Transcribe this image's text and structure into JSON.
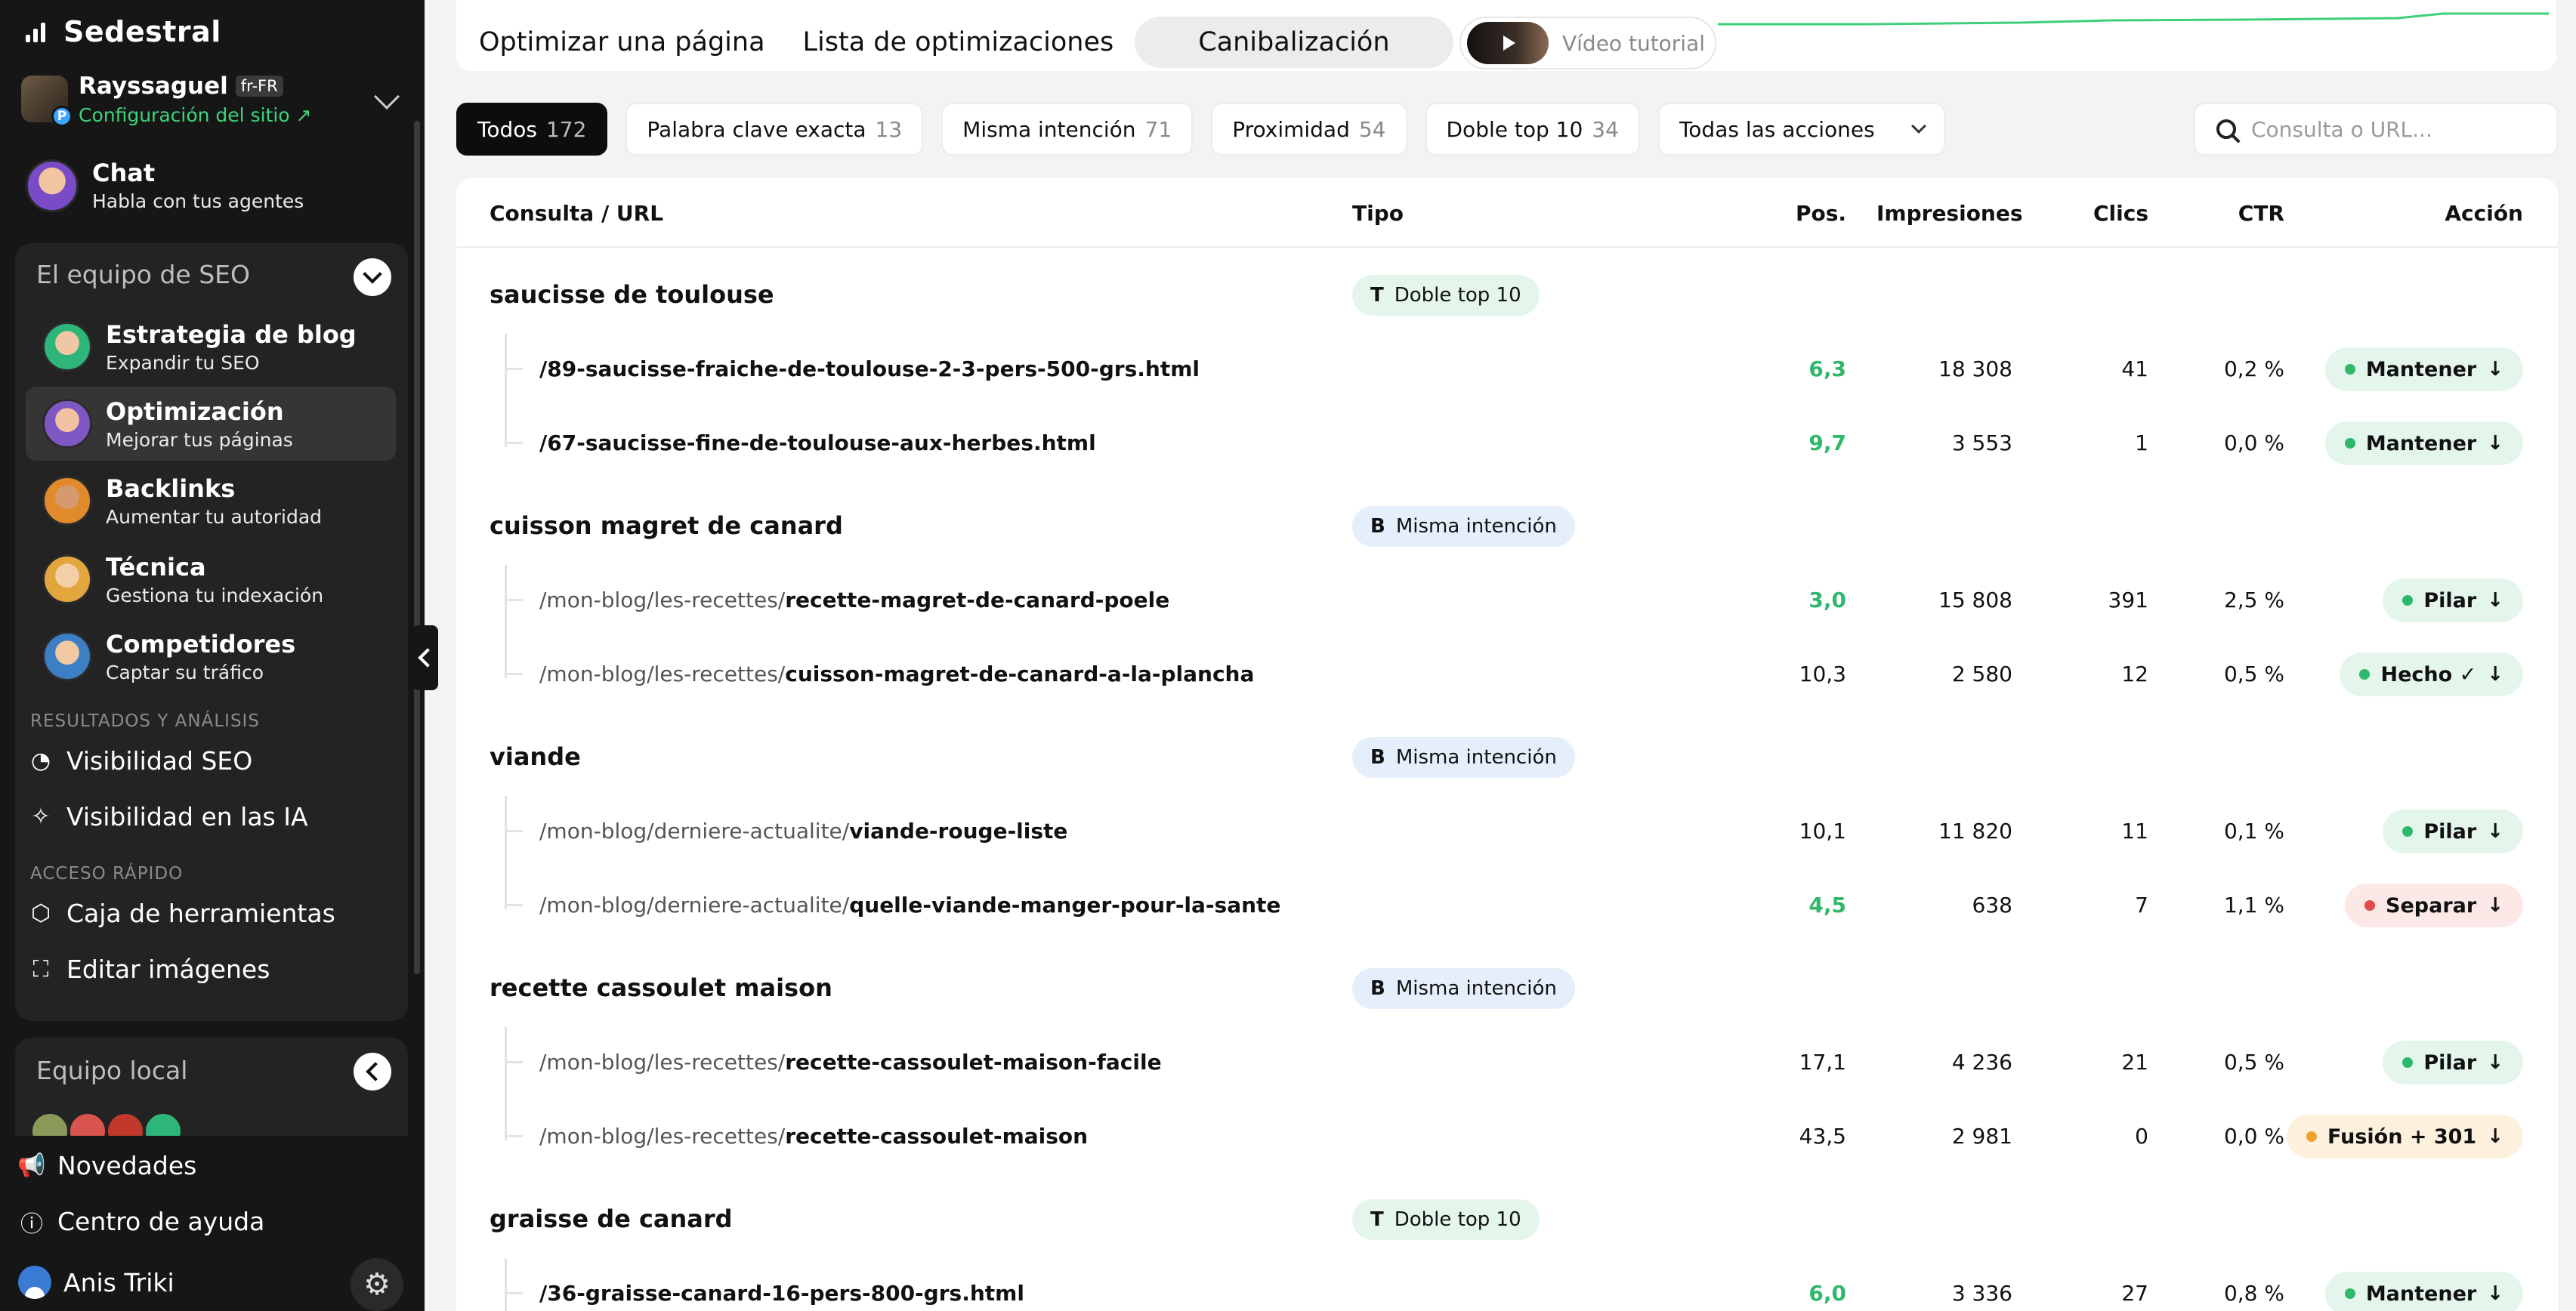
{
  "sidebar": {
    "brand": "Sedestral",
    "site": {
      "name": "Rayssaguel",
      "lang": "fr-FR",
      "config_link": "Configuración del sitio ↗",
      "badge": "P"
    },
    "chat": {
      "title": "Chat",
      "subtitle": "Habla con tus agentes"
    },
    "seo_team": {
      "title": "El equipo de SEO",
      "items": [
        {
          "title": "Estrategia de blog",
          "subtitle": "Expandir tu SEO"
        },
        {
          "title": "Optimización",
          "subtitle": "Mejorar tus páginas"
        },
        {
          "title": "Backlinks",
          "subtitle": "Aumentar tu autoridad"
        },
        {
          "title": "Técnica",
          "subtitle": "Gestiona tu indexación"
        },
        {
          "title": "Competidores",
          "subtitle": "Captar su tráfico"
        }
      ]
    },
    "results_label": "RESULTADOS Y ANÁLISIS",
    "results_items": [
      {
        "label": "Visibilidad SEO"
      },
      {
        "label": "Visibilidad en las IA"
      }
    ],
    "quick_label": "ACCESO RÁPIDO",
    "quick_items": [
      {
        "label": "Caja de herramientas"
      },
      {
        "label": "Editar imágenes"
      }
    ],
    "local_team": {
      "title": "Equipo local"
    },
    "bottom": {
      "news": "Novedades",
      "help": "Centro de ayuda",
      "user": "Anis Triki"
    }
  },
  "top": {
    "tabs": [
      "Optimizar una página",
      "Lista de optimizaciones",
      "Canibalización"
    ],
    "active_tab": 2,
    "video_label": "Vídeo tutorial"
  },
  "filters": [
    {
      "label": "Todos",
      "count": "172"
    },
    {
      "label": "Palabra clave exacta",
      "count": "13"
    },
    {
      "label": "Misma intención",
      "count": "71"
    },
    {
      "label": "Proximidad",
      "count": "54"
    },
    {
      "label": "Doble top 10",
      "count": "34"
    }
  ],
  "actions_select": "Todas las acciones",
  "search": {
    "placeholder": "Consulta o URL..."
  },
  "table": {
    "headers": {
      "query": "Consulta / URL",
      "type": "Tipo",
      "pos": "Pos.",
      "impressions": "Impresiones",
      "clicks": "Clics",
      "ctr": "CTR",
      "action": "Acción"
    },
    "groups": [
      {
        "query": "saucisse de toulouse",
        "type_letter": "T",
        "type": "Doble top 10",
        "rows": [
          {
            "prefix": "",
            "slug": "/89-saucisse-fraiche-de-toulouse-2-3-pers-500-grs.html",
            "pos": "6,3",
            "impressions": "18 308",
            "clicks": "41",
            "ctr": "0,2 %",
            "action": "Mantener"
          },
          {
            "prefix": "",
            "slug": "/67-saucisse-fine-de-toulouse-aux-herbes.html",
            "pos": "9,7",
            "impressions": "3 553",
            "clicks": "1",
            "ctr": "0,0 %",
            "action": "Mantener"
          }
        ]
      },
      {
        "query": "cuisson magret de canard",
        "type_letter": "B",
        "type": "Misma intención",
        "rows": [
          {
            "prefix": "/mon-blog/les-recettes/",
            "slug": "recette-magret-de-canard-poele",
            "pos": "3,0",
            "impressions": "15 808",
            "clicks": "391",
            "ctr": "2,5 %",
            "action": "Pilar"
          },
          {
            "prefix": "/mon-blog/les-recettes/",
            "slug": "cuisson-magret-de-canard-a-la-plancha",
            "pos": "10,3",
            "impressions": "2 580",
            "clicks": "12",
            "ctr": "0,5 %",
            "action": "Hecho ✓"
          }
        ]
      },
      {
        "query": "viande",
        "type_letter": "B",
        "type": "Misma intención",
        "rows": [
          {
            "prefix": "/mon-blog/derniere-actualite/",
            "slug": "viande-rouge-liste",
            "pos": "10,1",
            "impressions": "11 820",
            "clicks": "11",
            "ctr": "0,1 %",
            "action": "Pilar"
          },
          {
            "prefix": "/mon-blog/derniere-actualite/",
            "slug": "quelle-viande-manger-pour-la-sante",
            "pos": "4,5",
            "impressions": "638",
            "clicks": "7",
            "ctr": "1,1 %",
            "action": "Separar"
          }
        ]
      },
      {
        "query": "recette cassoulet maison",
        "type_letter": "B",
        "type": "Misma intención",
        "rows": [
          {
            "prefix": "/mon-blog/les-recettes/",
            "slug": "recette-cassoulet-maison-facile",
            "pos": "17,1",
            "impressions": "4 236",
            "clicks": "21",
            "ctr": "0,5 %",
            "action": "Pilar"
          },
          {
            "prefix": "/mon-blog/les-recettes/",
            "slug": "recette-cassoulet-maison",
            "pos": "43,5",
            "impressions": "2 981",
            "clicks": "0",
            "ctr": "0,0 %",
            "action": "Fusión + 301"
          }
        ]
      },
      {
        "query": "graisse de canard",
        "type_letter": "T",
        "type": "Doble top 10",
        "rows": [
          {
            "prefix": "",
            "slug": "/36-graisse-canard-16-pers-800-grs.html",
            "pos": "6,0",
            "impressions": "3 336",
            "clicks": "27",
            "ctr": "0,8 %",
            "action": "Mantener"
          }
        ]
      }
    ]
  },
  "colors": {
    "good_position": "#2fb86b",
    "action_green": "#2fb86b",
    "action_red": "#e34b4b",
    "action_orange": "#f0a12b",
    "config_link": "#3ed47b"
  },
  "icons": {
    "brand": "bar-chart-icon",
    "results": [
      "pie-chart-icon",
      "sparkle-icon"
    ],
    "quick": [
      "cube-icon",
      "scan-image-icon"
    ],
    "bottom": [
      "megaphone-icon",
      "help-circle-icon",
      "user-icon",
      "gear-icon"
    ]
  }
}
